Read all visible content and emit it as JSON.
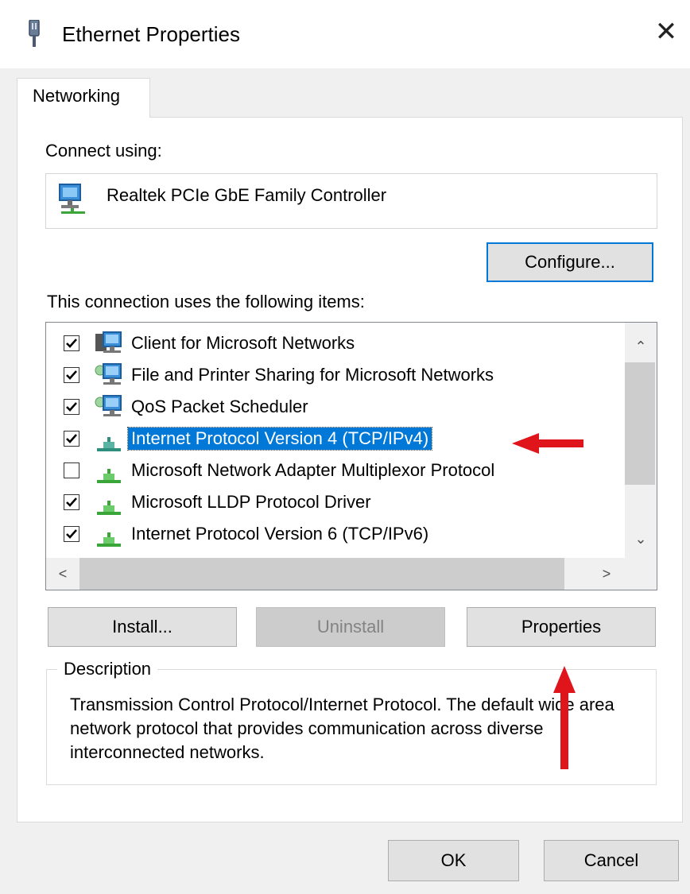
{
  "window": {
    "title": "Ethernet Properties",
    "close_glyph": "✕",
    "icon": "network-adapter-icon"
  },
  "tabs": [
    {
      "label": "Networking",
      "selected": true
    }
  ],
  "connect": {
    "label": "Connect using:",
    "adapter_name": "Realtek PCIe GbE Family Controller",
    "adapter_icon": "network-computer-icon",
    "configure_label": "Configure..."
  },
  "items": {
    "label": "This connection uses the following items:",
    "list": [
      {
        "label": "Client for Microsoft Networks",
        "checked": true,
        "icon": "network-client-icon",
        "selected": false
      },
      {
        "label": "File and Printer Sharing for Microsoft Networks",
        "checked": true,
        "icon": "network-service-icon",
        "selected": false
      },
      {
        "label": "QoS Packet Scheduler",
        "checked": true,
        "icon": "network-service-icon",
        "selected": false
      },
      {
        "label": "Internet Protocol Version 4 (TCP/IPv4)",
        "checked": true,
        "icon": "protocol-icon",
        "selected": true
      },
      {
        "label": "Microsoft Network Adapter Multiplexor Protocol",
        "checked": false,
        "icon": "protocol-icon",
        "selected": false
      },
      {
        "label": "Microsoft LLDP Protocol Driver",
        "checked": true,
        "icon": "protocol-icon",
        "selected": false
      },
      {
        "label": "Internet Protocol Version 6 (TCP/IPv6)",
        "checked": true,
        "icon": "protocol-icon",
        "selected": false
      }
    ],
    "scroll_up": "⌃",
    "scroll_down": "⌄",
    "scroll_left": "<",
    "scroll_right": ">"
  },
  "buttons": {
    "install": "Install...",
    "uninstall": "Uninstall",
    "properties": "Properties",
    "ok": "OK",
    "cancel": "Cancel"
  },
  "description": {
    "title": "Description",
    "text": "Transmission Control Protocol/Internet Protocol. The default wide area network protocol that provides communication across diverse interconnected networks."
  },
  "colors": {
    "selection": "#0078d7",
    "annotation_arrow": "#e0151b",
    "window_bg": "#f0f0f0",
    "panel_bg": "#ffffff"
  }
}
